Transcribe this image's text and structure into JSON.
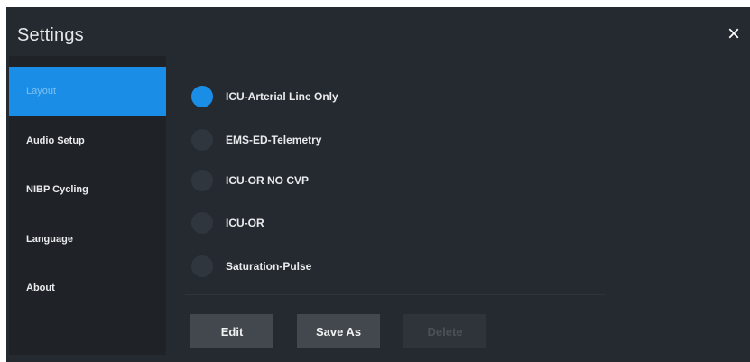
{
  "dialog": {
    "title": "Settings",
    "close_icon": "×"
  },
  "sidebar": {
    "items": [
      {
        "label": "Layout",
        "active": true
      },
      {
        "label": "Audio Setup",
        "active": false
      },
      {
        "label": "NIBP Cycling",
        "active": false
      },
      {
        "label": "Language",
        "active": false
      },
      {
        "label": "About",
        "active": false
      }
    ]
  },
  "layouts": {
    "options": [
      {
        "label": "ICU-Arterial Line Only",
        "selected": true
      },
      {
        "label": "EMS-ED-Telemetry",
        "selected": false
      },
      {
        "label": "ICU-OR NO CVP",
        "selected": false
      },
      {
        "label": "ICU-OR",
        "selected": false
      },
      {
        "label": "Saturation-Pulse",
        "selected": false
      }
    ]
  },
  "actions": {
    "edit_label": "Edit",
    "save_as_label": "Save As",
    "delete_label": "Delete",
    "delete_enabled": false
  },
  "colors": {
    "accent": "#1a8ee6",
    "panel_bg": "#252a30",
    "sidebar_bg": "#1f2328"
  }
}
